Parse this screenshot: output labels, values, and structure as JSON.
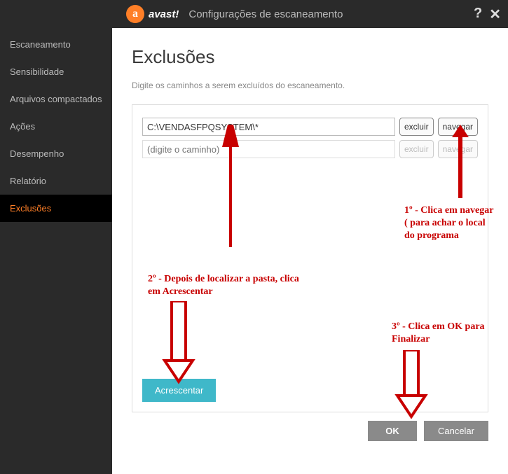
{
  "header": {
    "brand": "avast!",
    "title": "Configurações de escaneamento",
    "help": "?",
    "close": "✕"
  },
  "sidebar": {
    "items": [
      {
        "label": "Escaneamento"
      },
      {
        "label": "Sensibilidade"
      },
      {
        "label": "Arquivos compactados"
      },
      {
        "label": "Ações"
      },
      {
        "label": "Desempenho"
      },
      {
        "label": "Relatório"
      },
      {
        "label": "Exclusões"
      }
    ],
    "active_index": 6
  },
  "main": {
    "heading": "Exclusões",
    "description": "Digite os caminhos a serem excluídos do escaneamento.",
    "rows": [
      {
        "value": "C:\\VENDASFPQSYSTEM\\*",
        "placeholder": "",
        "enabled": true
      },
      {
        "value": "",
        "placeholder": "(digite o caminho)",
        "enabled": false
      }
    ],
    "row_buttons": {
      "delete": "excluir",
      "browse": "navegar"
    },
    "add_button": "Acrescentar"
  },
  "footer": {
    "ok": "OK",
    "cancel": "Cancelar"
  },
  "annotations": {
    "a1": "1º - Clica em navegar ( para achar o local do programa",
    "a2": "2º - Depois de localizar a pasta, clica em Acrescentar",
    "a3": "3º - Clica em OK para Finalizar"
  },
  "colors": {
    "accent_orange": "#ff7f27",
    "accent_teal": "#3fb8c9",
    "annotation_red": "#c80000"
  }
}
